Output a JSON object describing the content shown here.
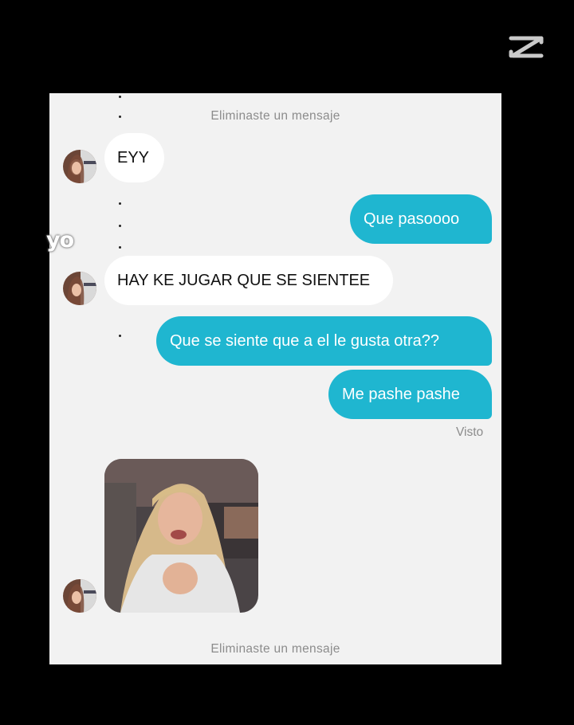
{
  "overlay": {
    "label": "yo",
    "logo_icon": "capcut-logo-icon"
  },
  "chat": {
    "deleted_top": "Eliminaste un mensaje",
    "deleted_bottom": "Eliminaste un mensaje",
    "seen": "Visto",
    "messages": [
      {
        "from": "them",
        "text": "EYY"
      },
      {
        "from": "me",
        "text": "Que pasoooo"
      },
      {
        "from": "them",
        "text": "HAY KE JUGAR QUE SE SIENTEE"
      },
      {
        "from": "me",
        "text": "Que se siente que a el le gusta otra??"
      },
      {
        "from": "me",
        "text": "Me pashe pashe"
      }
    ],
    "colors": {
      "outgoing_bubble": "#1fb6d0",
      "incoming_bubble": "#ffffff",
      "background": "#f2f2f2"
    }
  }
}
